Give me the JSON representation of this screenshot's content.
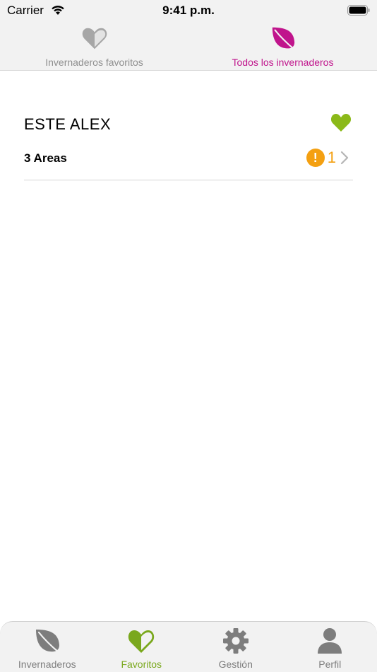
{
  "status_bar": {
    "carrier": "Carrier",
    "time": "9:41 p.m."
  },
  "top_tabs": [
    {
      "label": "Invernaderos favoritos",
      "icon": "half-heart-icon",
      "active": false
    },
    {
      "label": "Todos los invernaderos",
      "icon": "leaf-icon",
      "active": true
    }
  ],
  "greenhouses": [
    {
      "name": "ESTE ALEX",
      "areas_label": "3 Areas",
      "alert_symbol": "!",
      "alert_count": "1",
      "favorite": true
    }
  ],
  "bottom_tabs": [
    {
      "label": "Invernaderos",
      "icon": "leaf-icon",
      "active": false
    },
    {
      "label": "Favoritos",
      "icon": "half-heart-icon",
      "active": true
    },
    {
      "label": "Gestión",
      "icon": "gear-icon",
      "active": false
    },
    {
      "label": "Perfil",
      "icon": "person-icon",
      "active": false
    }
  ],
  "colors": {
    "accent_magenta": "#c0148c",
    "accent_green": "#7aa81d",
    "favorite_green": "#8bb919",
    "alert_orange": "#f4a011",
    "inactive_gray": "#8e8e8e"
  }
}
